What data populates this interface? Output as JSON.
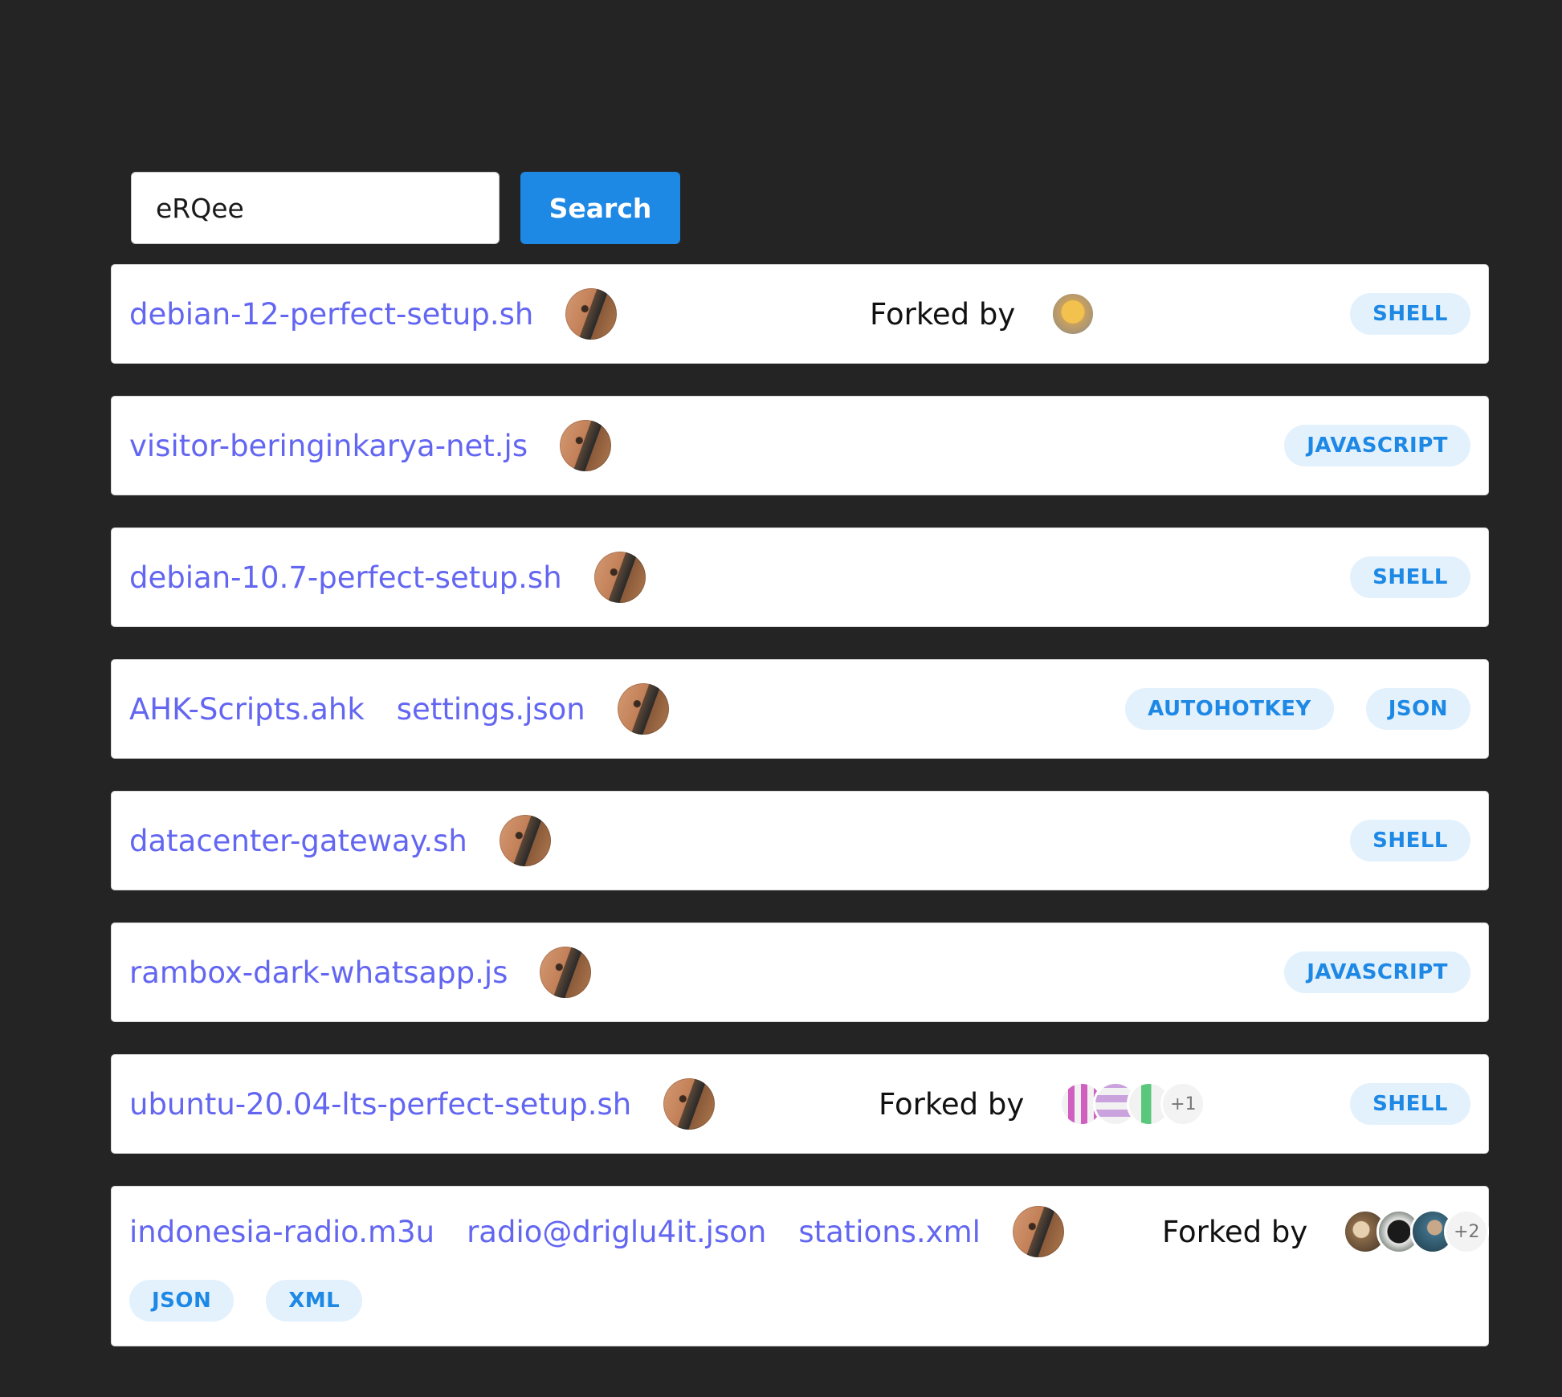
{
  "search": {
    "value": "eRQee",
    "button_label": "Search"
  },
  "forked_by_label": "Forked by",
  "gists": [
    {
      "files": [
        "debian-12-perfect-setup.sh"
      ],
      "forks": {
        "avatars": [
          "yellow"
        ],
        "more": ""
      },
      "tags": [
        "SHELL"
      ]
    },
    {
      "files": [
        "visitor-beringinkarya-net.js"
      ],
      "forks": null,
      "tags": [
        "JAVASCRIPT"
      ]
    },
    {
      "files": [
        "debian-10.7-perfect-setup.sh"
      ],
      "forks": null,
      "tags": [
        "SHELL"
      ]
    },
    {
      "files": [
        "AHK-Scripts.ahk",
        "settings.json"
      ],
      "forks": null,
      "tags": [
        "AUTOHOTKEY",
        "JSON"
      ]
    },
    {
      "files": [
        "datacenter-gateway.sh"
      ],
      "forks": null,
      "tags": [
        "SHELL"
      ]
    },
    {
      "files": [
        "rambox-dark-whatsapp.js"
      ],
      "forks": null,
      "tags": [
        "JAVASCRIPT"
      ]
    },
    {
      "files": [
        "ubuntu-20.04-lts-perfect-setup.sh"
      ],
      "forks": {
        "avatars": [
          "pink",
          "lilac",
          "green"
        ],
        "more": "+1"
      },
      "tags": [
        "SHELL"
      ]
    },
    {
      "files": [
        "indonesia-radio.m3u",
        "radio@driglu4it.json",
        "stations.xml"
      ],
      "forks": {
        "avatars": [
          "brown",
          "dark",
          "teal"
        ],
        "more": "+2"
      },
      "tags": [
        "JSON",
        "XML"
      ]
    }
  ],
  "colors": {
    "background": "#242424",
    "link": "#6366f1",
    "accent": "#1e88e5",
    "tag_bg": "#e3f1fd"
  }
}
